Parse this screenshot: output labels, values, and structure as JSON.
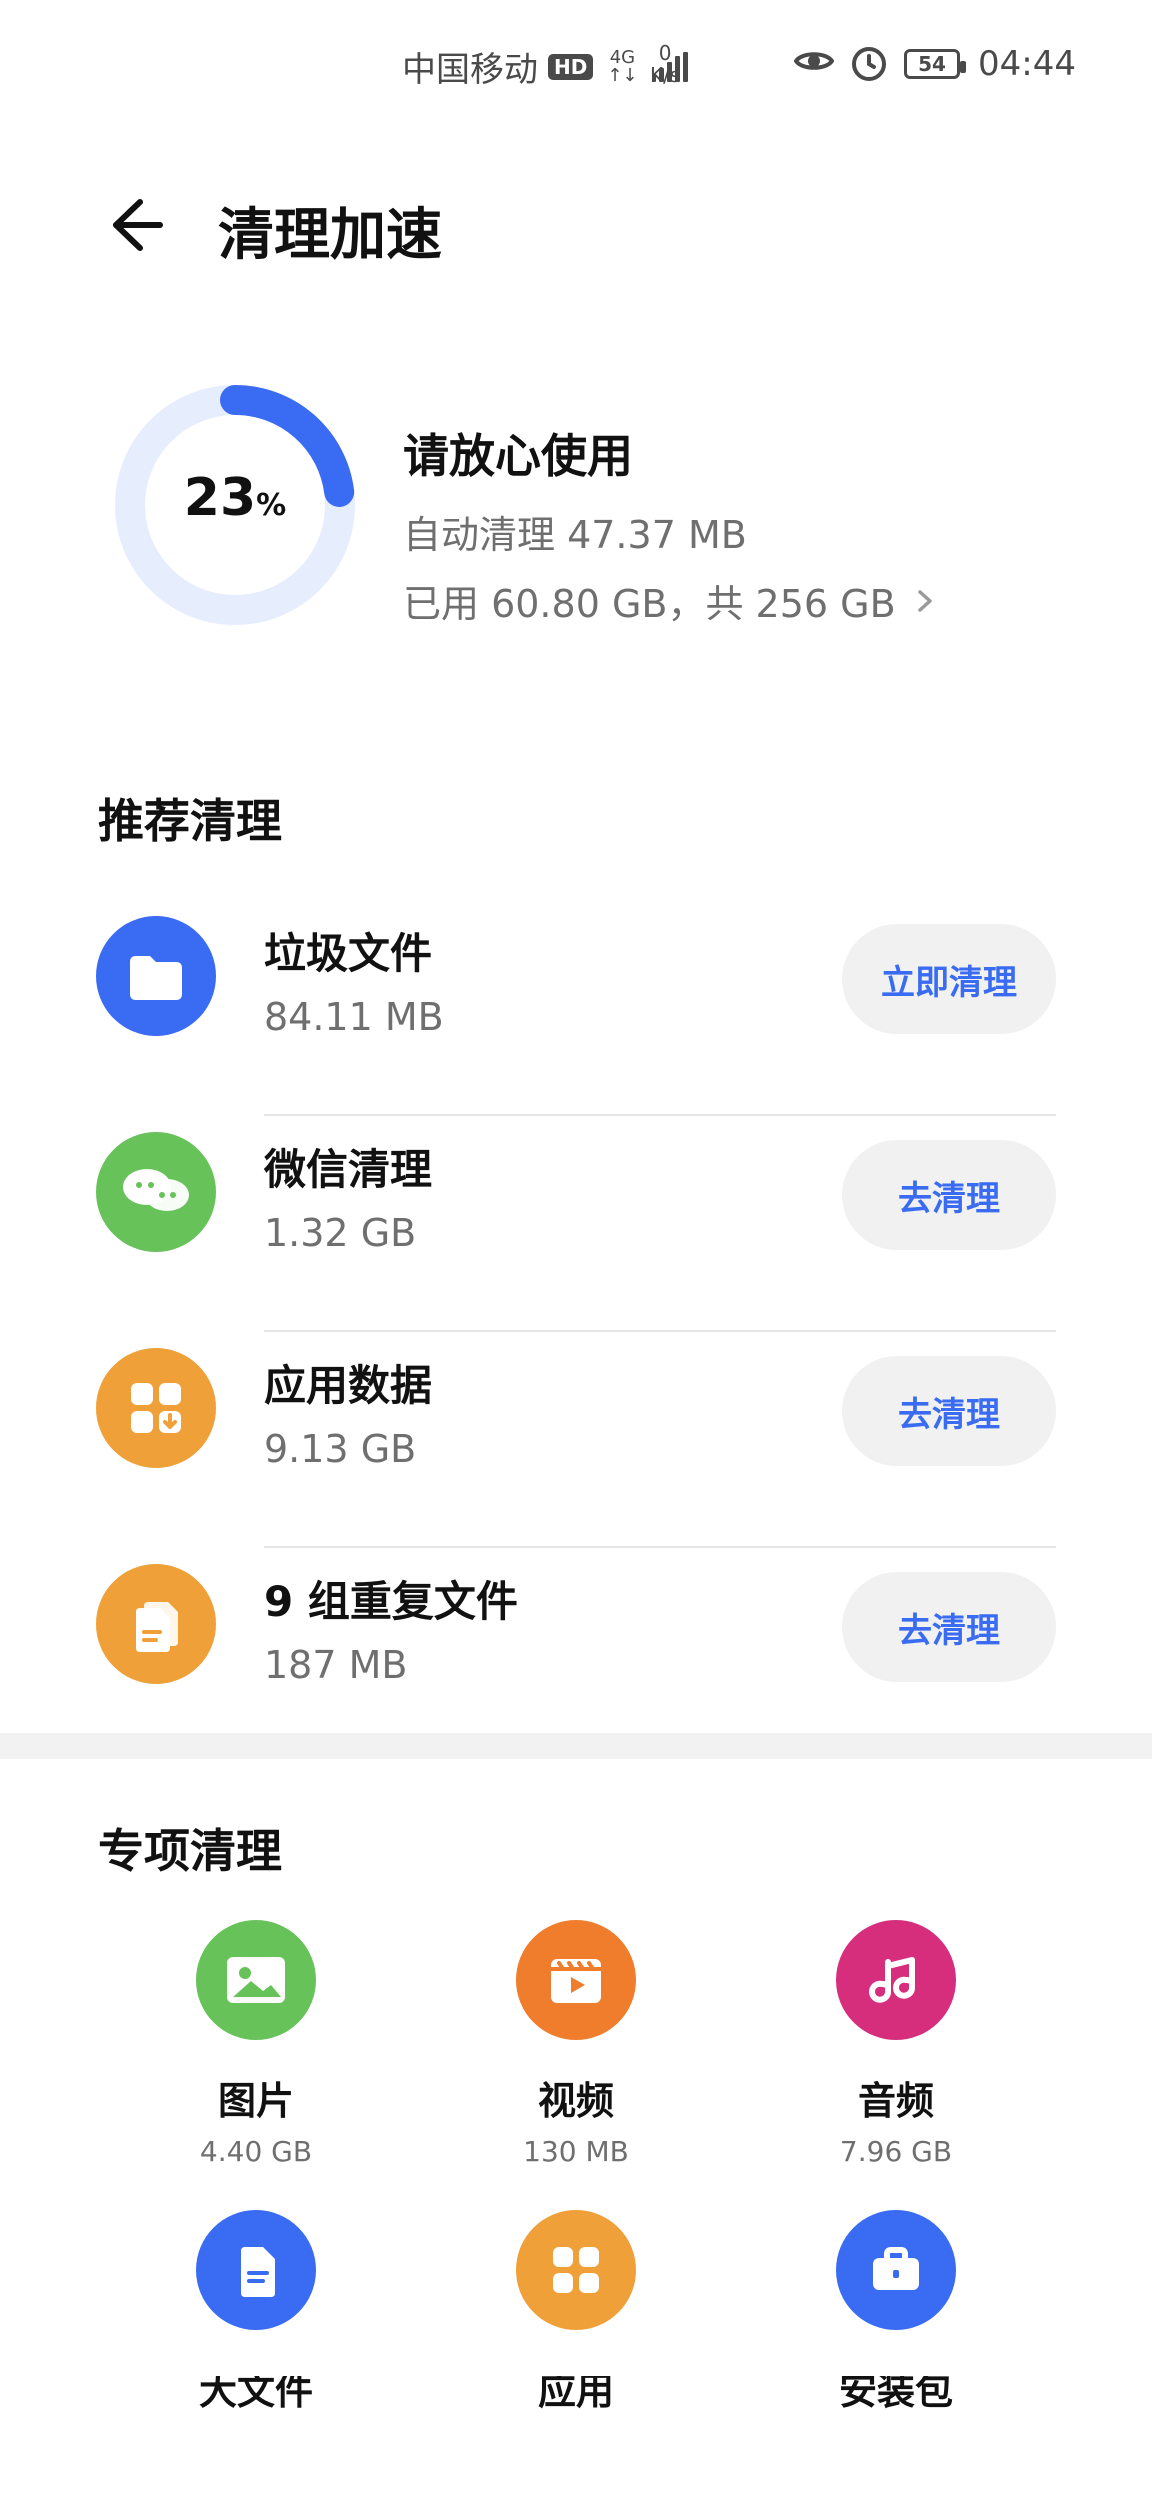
{
  "status_bar": {
    "carrier": "中国移动",
    "hd": "HD",
    "network_label": "4G",
    "speed_value": "0",
    "speed_unit": "K/s",
    "battery": "54",
    "time": "04:44"
  },
  "header": {
    "title": "清理加速"
  },
  "summary": {
    "percent": "23",
    "percent_unit": "%",
    "progress": 0.23,
    "status": "请放心使用",
    "auto_clean": "自动清理 47.37 MB",
    "usage": "已用 60.80 GB，共 256 GB"
  },
  "recommended": {
    "title": "推荐清理",
    "items": [
      {
        "name": "垃圾文件",
        "size": "84.11 MB",
        "button": "立即清理",
        "icon": "folder-icon",
        "color": "#3a6cf3"
      },
      {
        "name": "微信清理",
        "size": "1.32 GB",
        "button": "去清理",
        "icon": "wechat-icon",
        "color": "#67c25a"
      },
      {
        "name": "应用数据",
        "size": "9.13 GB",
        "button": "去清理",
        "icon": "apps-download-icon",
        "color": "#f0a038"
      },
      {
        "name": "9 组重复文件",
        "size": "187 MB",
        "button": "去清理",
        "icon": "duplicate-files-icon",
        "color": "#f0a038"
      }
    ]
  },
  "special": {
    "title": "专项清理",
    "items": [
      {
        "label": "图片",
        "size": "4.40 GB",
        "icon": "image-icon",
        "color": "#67c25a"
      },
      {
        "label": "视频",
        "size": "130 MB",
        "icon": "video-icon",
        "color": "#ef7d2b"
      },
      {
        "label": "音频",
        "size": "7.96 GB",
        "icon": "music-icon",
        "color": "#d62e7d"
      },
      {
        "label": "大文件",
        "size": "",
        "icon": "document-icon",
        "color": "#3a6cf3"
      },
      {
        "label": "应用",
        "size": "",
        "icon": "apps-icon",
        "color": "#f0a038"
      },
      {
        "label": "安装包",
        "size": "",
        "icon": "package-icon",
        "color": "#3a6cf3"
      }
    ]
  }
}
